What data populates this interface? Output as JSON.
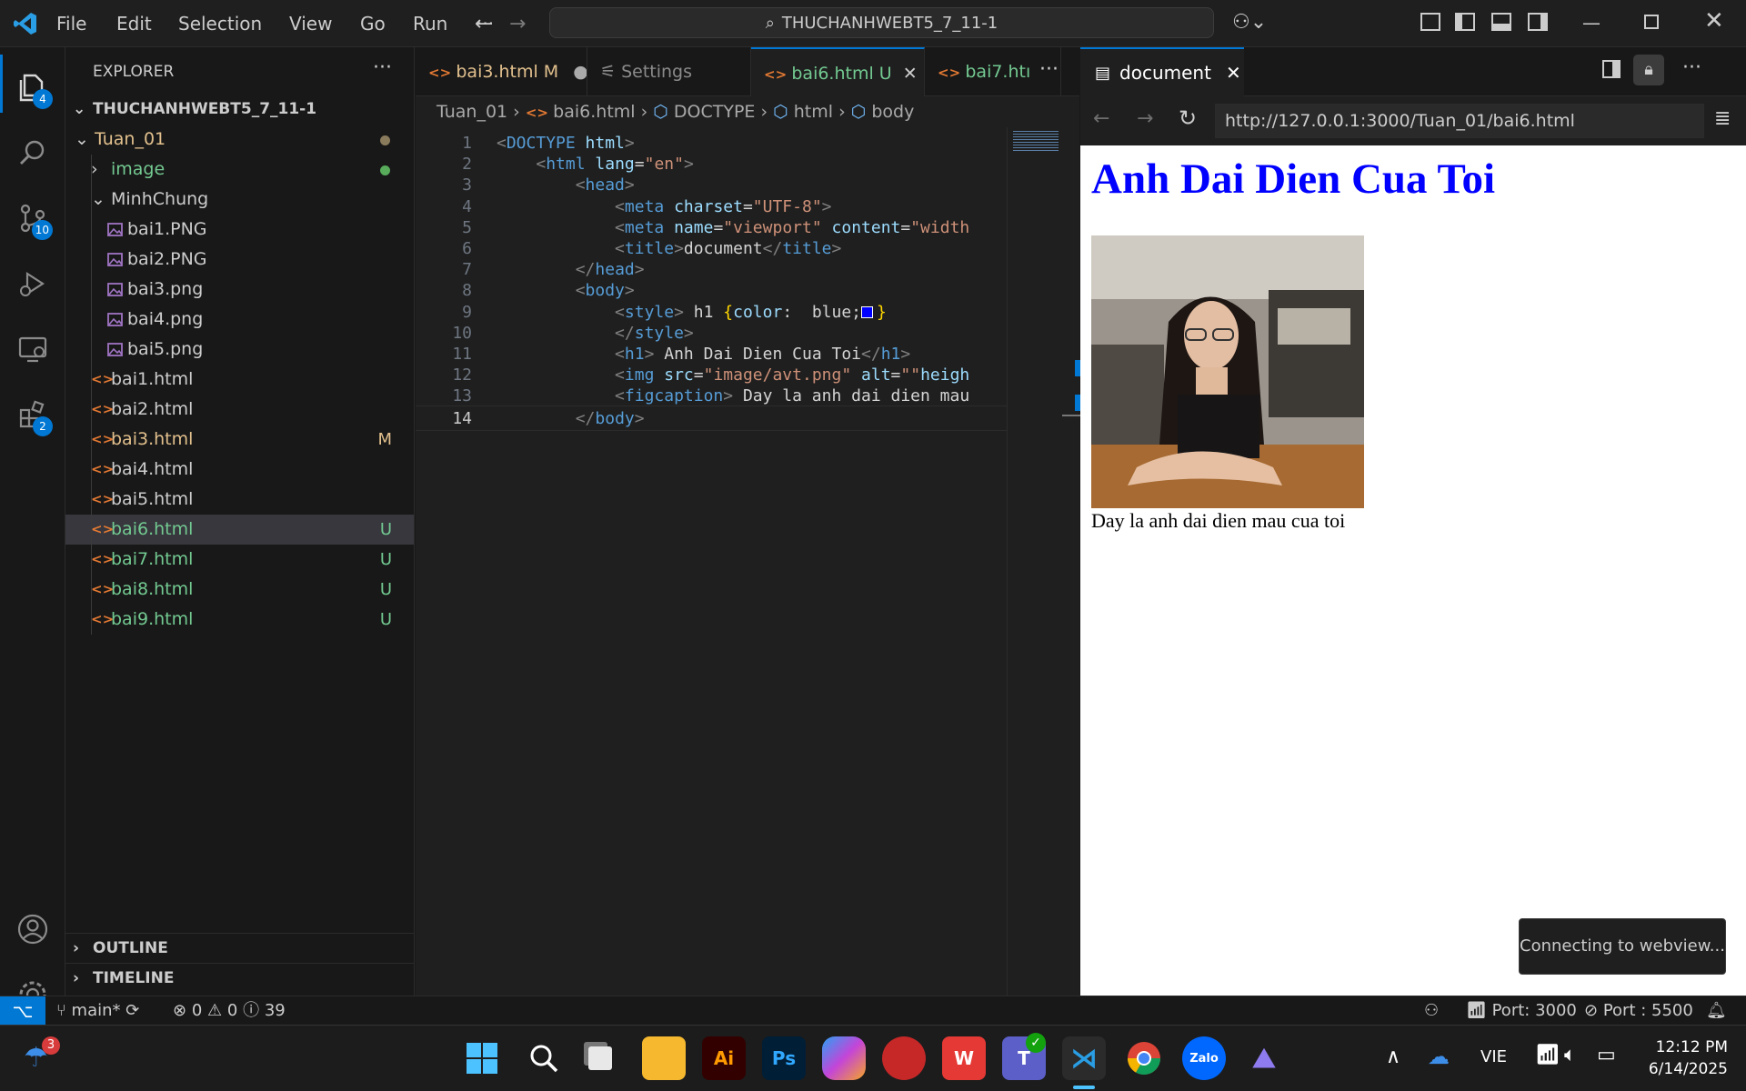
{
  "menu": [
    "File",
    "Edit",
    "Selection",
    "View",
    "Go",
    "Run",
    "···"
  ],
  "command_center": "THUCHANHWEBT5_7_11-1",
  "activity_badges": {
    "explorer": "4",
    "scm": "10",
    "extensions": "2"
  },
  "sidebar": {
    "title": "EXPLORER",
    "root": "THUCHANHWEBT5_7_11-1",
    "items": [
      {
        "label": "Tuan_01",
        "indent": 1,
        "kind": "folder-open",
        "color": "#e2c08d",
        "mark": "dot",
        "markColor": "#8a7b5c"
      },
      {
        "label": "image",
        "indent": 2,
        "kind": "folder",
        "color": "#73c991",
        "mark": "dot",
        "markColor": "#57ab5a"
      },
      {
        "label": "MinhChung",
        "indent": 2,
        "kind": "folder-open",
        "color": "#cccccc",
        "mark": ""
      },
      {
        "label": "bai1.PNG",
        "indent": 3,
        "kind": "image",
        "color": "#cccccc",
        "mark": ""
      },
      {
        "label": "bai2.PNG",
        "indent": 3,
        "kind": "image",
        "color": "#cccccc",
        "mark": ""
      },
      {
        "label": "bai3.png",
        "indent": 3,
        "kind": "image",
        "color": "#cccccc",
        "mark": ""
      },
      {
        "label": "bai4.png",
        "indent": 3,
        "kind": "image",
        "color": "#cccccc",
        "mark": ""
      },
      {
        "label": "bai5.png",
        "indent": 3,
        "kind": "image",
        "color": "#cccccc",
        "mark": ""
      },
      {
        "label": "bai1.html",
        "indent": 2,
        "kind": "html",
        "color": "#cccccc",
        "mark": ""
      },
      {
        "label": "bai2.html",
        "indent": 2,
        "kind": "html",
        "color": "#cccccc",
        "mark": ""
      },
      {
        "label": "bai3.html",
        "indent": 2,
        "kind": "html",
        "color": "#e2c08d",
        "mark": "M",
        "markColor": "#e2c08d"
      },
      {
        "label": "bai4.html",
        "indent": 2,
        "kind": "html",
        "color": "#cccccc",
        "mark": ""
      },
      {
        "label": "bai5.html",
        "indent": 2,
        "kind": "html",
        "color": "#cccccc",
        "mark": ""
      },
      {
        "label": "bai6.html",
        "indent": 2,
        "kind": "html",
        "color": "#73c991",
        "mark": "U",
        "markColor": "#73c991",
        "selected": true
      },
      {
        "label": "bai7.html",
        "indent": 2,
        "kind": "html",
        "color": "#73c991",
        "mark": "U",
        "markColor": "#73c991"
      },
      {
        "label": "bai8.html",
        "indent": 2,
        "kind": "html",
        "color": "#73c991",
        "mark": "U",
        "markColor": "#73c991"
      },
      {
        "label": "bai9.html",
        "indent": 2,
        "kind": "html",
        "color": "#73c991",
        "mark": "U",
        "markColor": "#73c991"
      }
    ],
    "outline": "OUTLINE",
    "timeline": "TIMELINE"
  },
  "editor": {
    "tabs": [
      {
        "label": "bai3.html",
        "suffix": "M",
        "color": "#e2c08d"
      },
      {
        "label": "Settings",
        "suffix": "",
        "color": "#8b8b8b"
      },
      {
        "label": "bai6.html",
        "suffix": "U",
        "color": "#73c991",
        "active": true
      },
      {
        "label": "bai7.htı",
        "suffix": "",
        "color": "#73c991"
      }
    ],
    "breadcrumb": [
      "Tuan_01",
      "bai6.html",
      "DOCTYPE",
      "html",
      "body"
    ],
    "code": [
      [
        [
          "p",
          "<"
        ],
        [
          "t",
          "DOCTYPE"
        ],
        [
          "w",
          " "
        ],
        [
          "a",
          "html"
        ],
        [
          "p",
          ">"
        ]
      ],
      [
        [
          "w",
          "    "
        ],
        [
          "p",
          "<"
        ],
        [
          "t",
          "html"
        ],
        [
          "w",
          " "
        ],
        [
          "a",
          "lang"
        ],
        [
          "w",
          "="
        ],
        [
          "s",
          "\"en\""
        ],
        [
          "p",
          ">"
        ]
      ],
      [
        [
          "w",
          "        "
        ],
        [
          "p",
          "<"
        ],
        [
          "t",
          "head"
        ],
        [
          "p",
          ">"
        ]
      ],
      [
        [
          "w",
          "            "
        ],
        [
          "p",
          "<"
        ],
        [
          "t",
          "meta"
        ],
        [
          "w",
          " "
        ],
        [
          "a",
          "charset"
        ],
        [
          "w",
          "="
        ],
        [
          "s",
          "\"UTF-8\""
        ],
        [
          "p",
          ">"
        ]
      ],
      [
        [
          "w",
          "            "
        ],
        [
          "p",
          "<"
        ],
        [
          "t",
          "meta"
        ],
        [
          "w",
          " "
        ],
        [
          "a",
          "name"
        ],
        [
          "w",
          "="
        ],
        [
          "s",
          "\"viewport\""
        ],
        [
          "w",
          " "
        ],
        [
          "a",
          "content"
        ],
        [
          "w",
          "="
        ],
        [
          "s",
          "\"width"
        ]
      ],
      [
        [
          "w",
          "            "
        ],
        [
          "p",
          "<"
        ],
        [
          "t",
          "title"
        ],
        [
          "p",
          ">"
        ],
        [
          "w",
          "document"
        ],
        [
          "p",
          "</"
        ],
        [
          "t",
          "title"
        ],
        [
          "p",
          ">"
        ]
      ],
      [
        [
          "w",
          "        "
        ],
        [
          "p",
          "</"
        ],
        [
          "t",
          "head"
        ],
        [
          "p",
          ">"
        ]
      ],
      [
        [
          "w",
          "        "
        ],
        [
          "p",
          "<"
        ],
        [
          "t",
          "body"
        ],
        [
          "p",
          ">"
        ]
      ],
      [
        [
          "w",
          "            "
        ],
        [
          "p",
          "<"
        ],
        [
          "t",
          "style"
        ],
        [
          "p",
          ">"
        ],
        [
          "w",
          " h1 "
        ],
        [
          "y",
          "{"
        ],
        [
          "a",
          "color"
        ],
        [
          "w",
          ":  "
        ],
        [
          "w",
          "blue;"
        ],
        [
          "y",
          "}"
        ]
      ],
      [
        [
          "w",
          "            "
        ],
        [
          "p",
          "</"
        ],
        [
          "t",
          "style"
        ],
        [
          "p",
          ">"
        ]
      ],
      [
        [
          "w",
          "            "
        ],
        [
          "p",
          "<"
        ],
        [
          "t",
          "h1"
        ],
        [
          "p",
          ">"
        ],
        [
          "w",
          " Anh Dai Dien Cua Toi"
        ],
        [
          "p",
          "</"
        ],
        [
          "t",
          "h1"
        ],
        [
          "p",
          ">"
        ]
      ],
      [
        [
          "w",
          "            "
        ],
        [
          "p",
          "<"
        ],
        [
          "t",
          "img"
        ],
        [
          "w",
          " "
        ],
        [
          "a",
          "src"
        ],
        [
          "w",
          "="
        ],
        [
          "s",
          "\"image/avt.png\""
        ],
        [
          "w",
          " "
        ],
        [
          "a",
          "alt"
        ],
        [
          "w",
          "="
        ],
        [
          "s",
          "\"\""
        ],
        [
          "a",
          "heigh"
        ]
      ],
      [
        [
          "w",
          "            "
        ],
        [
          "p",
          "<"
        ],
        [
          "t",
          "figcaption"
        ],
        [
          "p",
          ">"
        ],
        [
          "w",
          " Day la anh dai dien mau"
        ]
      ],
      [
        [
          "w",
          "        "
        ],
        [
          "p",
          "</"
        ],
        [
          "t",
          "body"
        ],
        [
          "p",
          ">"
        ]
      ]
    ]
  },
  "preview": {
    "tab": "document",
    "url": "http://127.0.0.1:3000/Tuan_01/bai6.html",
    "heading": "Anh Dai Dien Cua Toi",
    "caption": "Day la anh dai dien mau cua toi",
    "toast": "Connecting to webview..."
  },
  "statusbar": {
    "branch": "main*",
    "errors": "0",
    "warnings": "0",
    "infos": "39",
    "port1": "Port: 3000",
    "port2": "Port : 5500"
  },
  "taskbar": {
    "notif": "3",
    "lang": "VIE",
    "time": "12:12 PM",
    "date": "6/14/2025"
  },
  "colors": {
    "accent": "#0078d4",
    "heading_blue": "#0000ff"
  }
}
